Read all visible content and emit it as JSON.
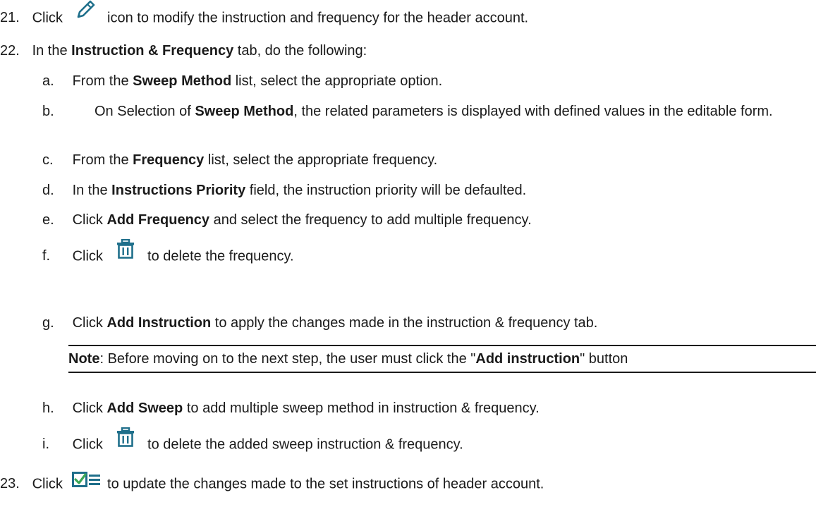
{
  "steps": {
    "s21": {
      "num": "21.",
      "click": "Click",
      "icon": "pencil-icon",
      "rest": "icon to modify the instruction and frequency for the header account."
    },
    "s22": {
      "num": "22.",
      "pre": "In the",
      "tab": "Instruction & Frequency",
      "post": "tab, do the following:"
    },
    "s23": {
      "num": "23.",
      "click": "Click",
      "icon": "update-checklist-icon",
      "rest": "to update the changes made to the set instructions of header account."
    }
  },
  "substeps": {
    "a": {
      "letter": "a.",
      "pre": "From the",
      "bold": "Sweep Method",
      "post": "list, select the appropriate option."
    },
    "b": {
      "letter": "b.",
      "pre": "On Selection of",
      "bold": "Sweep Method",
      "post": ", the related parameters is displayed with defined values in the editable form."
    },
    "c": {
      "letter": "c.",
      "pre": "From the",
      "bold": "Frequency",
      "post": "list, select the appropriate frequency."
    },
    "d": {
      "letter": "d.",
      "pre": "In the",
      "bold": "Instructions Priority",
      "post": "field, the instruction priority will be defaulted."
    },
    "e": {
      "letter": "e.",
      "pre": "Click",
      "bold": "Add Frequency",
      "post": "and select the frequency to add multiple frequency."
    },
    "f": {
      "letter": "f.",
      "pre": "Click",
      "icon": "trash-icon",
      "post": "to delete the frequency."
    },
    "g": {
      "letter": "g.",
      "pre": "Click",
      "bold": "Add Instruction",
      "post": "to apply the changes made in the instruction & frequency tab."
    },
    "h": {
      "letter": "h.",
      "pre": "Click",
      "bold": "Add Sweep",
      "post": "to add multiple sweep method in instruction & frequency."
    },
    "i": {
      "letter": "i.",
      "pre": "Click",
      "icon": "trash-icon",
      "post": "to delete the added sweep instruction & frequency."
    }
  },
  "note": {
    "label": "Note",
    "pre": ": Before moving on to the next step, the user must click the \"",
    "bold": "Add instruction",
    "post": "\" button"
  },
  "colors": {
    "text": "#1a1a1a",
    "icon_teal": "#1f6f8b",
    "icon_green": "#3aa655"
  }
}
